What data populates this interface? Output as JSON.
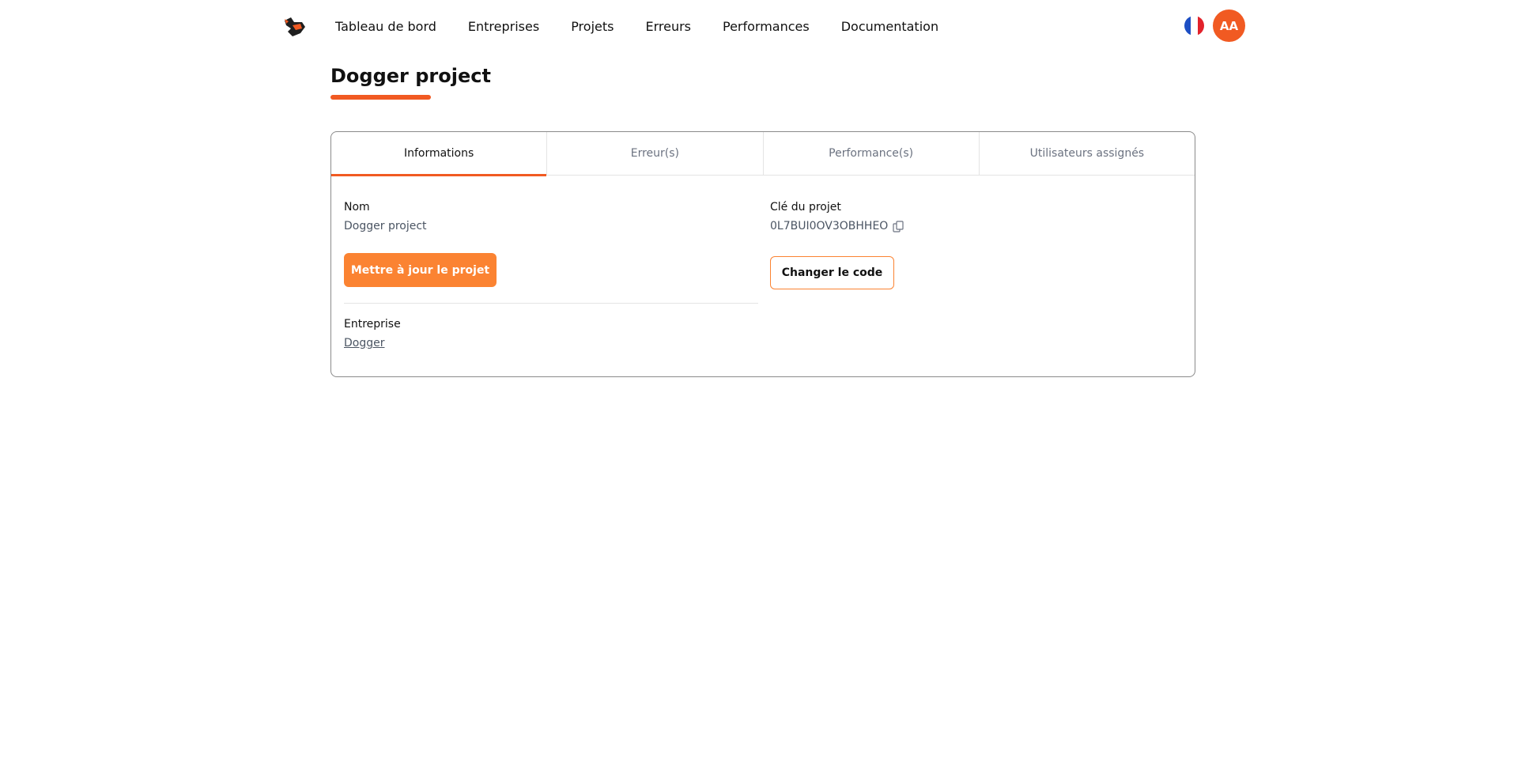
{
  "nav": {
    "links": [
      "Tableau de bord",
      "Entreprises",
      "Projets",
      "Erreurs",
      "Performances",
      "Documentation"
    ],
    "language_icon": "french-flag-icon",
    "avatar_initials": "AA"
  },
  "page": {
    "title": "Dogger project"
  },
  "tabs": [
    {
      "label": "Informations",
      "active": true
    },
    {
      "label": "Erreur(s)",
      "active": false
    },
    {
      "label": "Performance(s)",
      "active": false
    },
    {
      "label": "Utilisateurs assignés",
      "active": false
    }
  ],
  "info": {
    "name_label": "Nom",
    "name_value": "Dogger project",
    "update_button": "Mettre à jour le projet",
    "company_label": "Entreprise",
    "company_value": "Dogger",
    "key_label": "Clé du projet",
    "key_value": "0L7BUI0OV3OBHHEO",
    "change_code_button": "Changer le code"
  },
  "colors": {
    "accent": "#f15a22",
    "button": "#fb8332"
  }
}
